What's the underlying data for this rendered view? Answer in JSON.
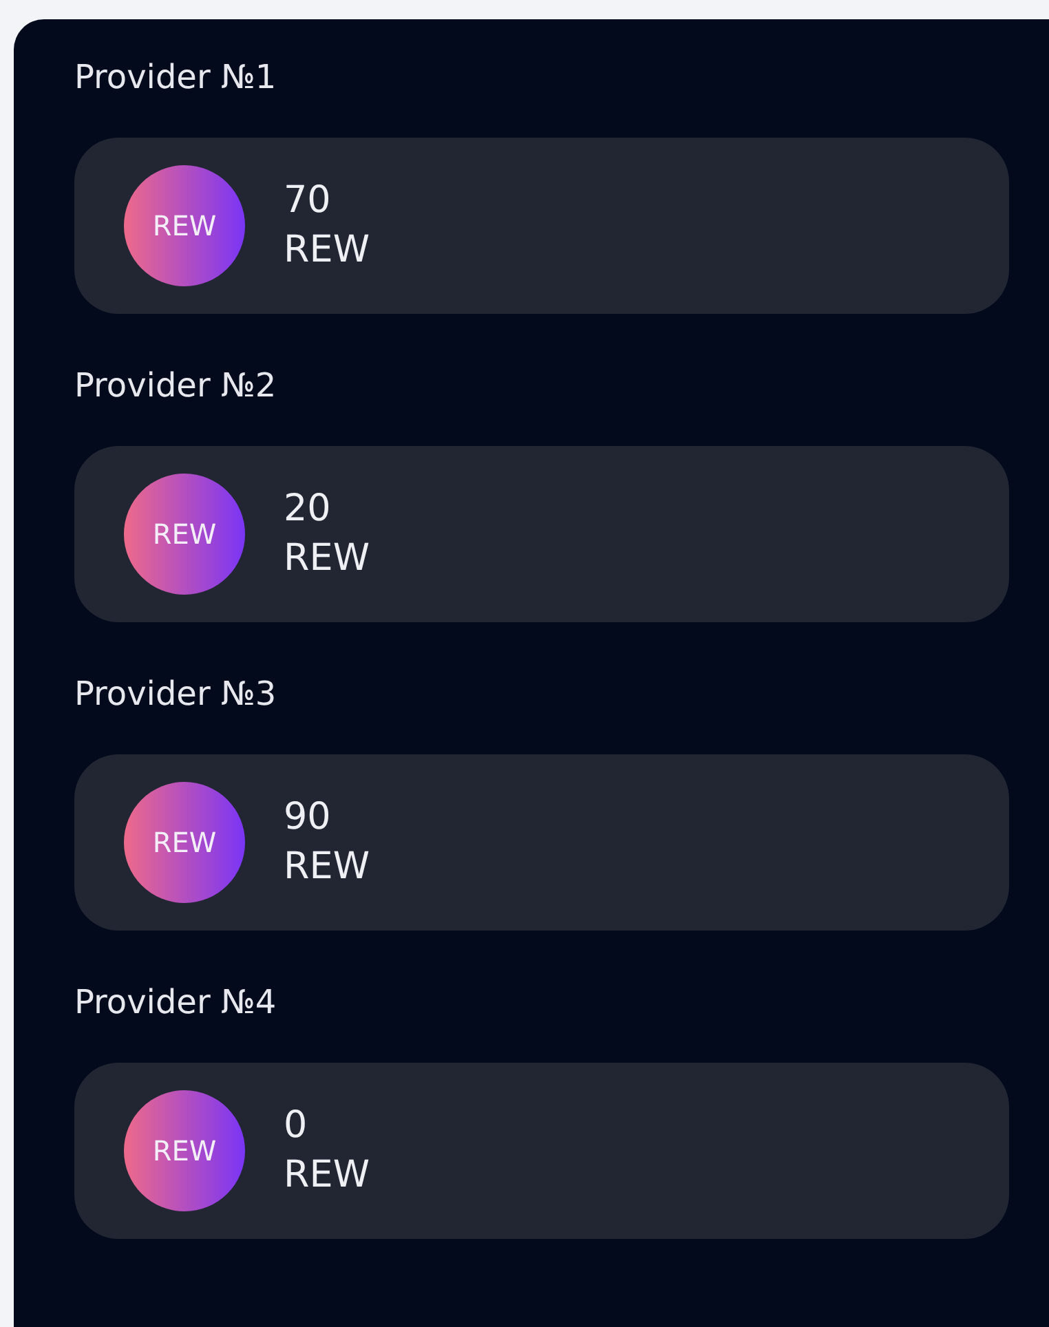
{
  "providers": [
    {
      "title": "Provider №1",
      "token": "REW",
      "amount": "70",
      "unit": "REW"
    },
    {
      "title": "Provider №2",
      "token": "REW",
      "amount": "20",
      "unit": "REW"
    },
    {
      "title": "Provider №3",
      "token": "REW",
      "amount": "90",
      "unit": "REW"
    },
    {
      "title": "Provider №4",
      "token": "REW",
      "amount": "0",
      "unit": "REW"
    }
  ]
}
